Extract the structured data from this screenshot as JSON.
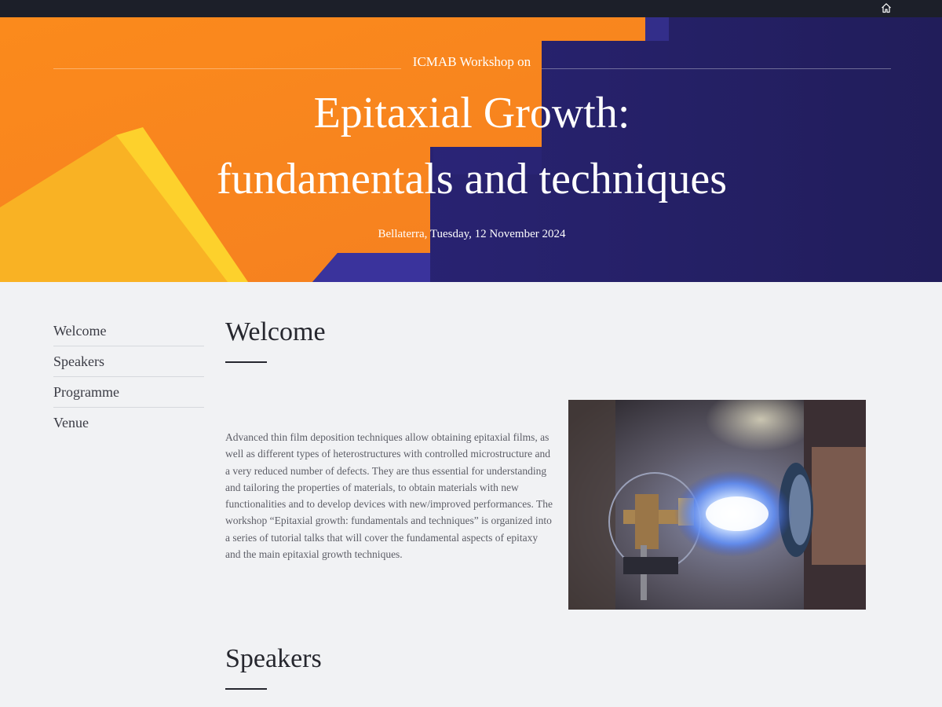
{
  "hero": {
    "kicker": "ICMAB Workshop on",
    "title_line1": "Epitaxial Growth:",
    "title_line2": "fundamentals and techniques",
    "date": "Bellaterra, Tuesday, 12 November 2024"
  },
  "topbar": {
    "home_icon": "home-icon"
  },
  "sidebar": {
    "items": [
      {
        "label": "Welcome"
      },
      {
        "label": "Speakers"
      },
      {
        "label": "Programme"
      },
      {
        "label": "Venue"
      }
    ]
  },
  "welcome": {
    "title": "Welcome",
    "body": "Advanced thin film deposition techniques allow obtaining epitaxial films, as well as different types of heterostructures with controlled microstructure and a very reduced number of defects. They are thus essential for understanding and tailoring the properties of materials, to obtain materials with new functionalities and to develop devices with new/improved performances. The workshop “Epitaxial growth: fundamentals and techniques” is organized into a series of tutorial talks that will cover the fundamental aspects of epitaxy and the main epitaxial growth techniques."
  },
  "speakers": {
    "title": "Speakers"
  },
  "colors": {
    "hero_orange": "#f7881d",
    "hero_navy": "#24215f",
    "hero_yellow": "#fcc225",
    "topbar": "#1c1f29",
    "page_background": "#f1f2f4"
  }
}
